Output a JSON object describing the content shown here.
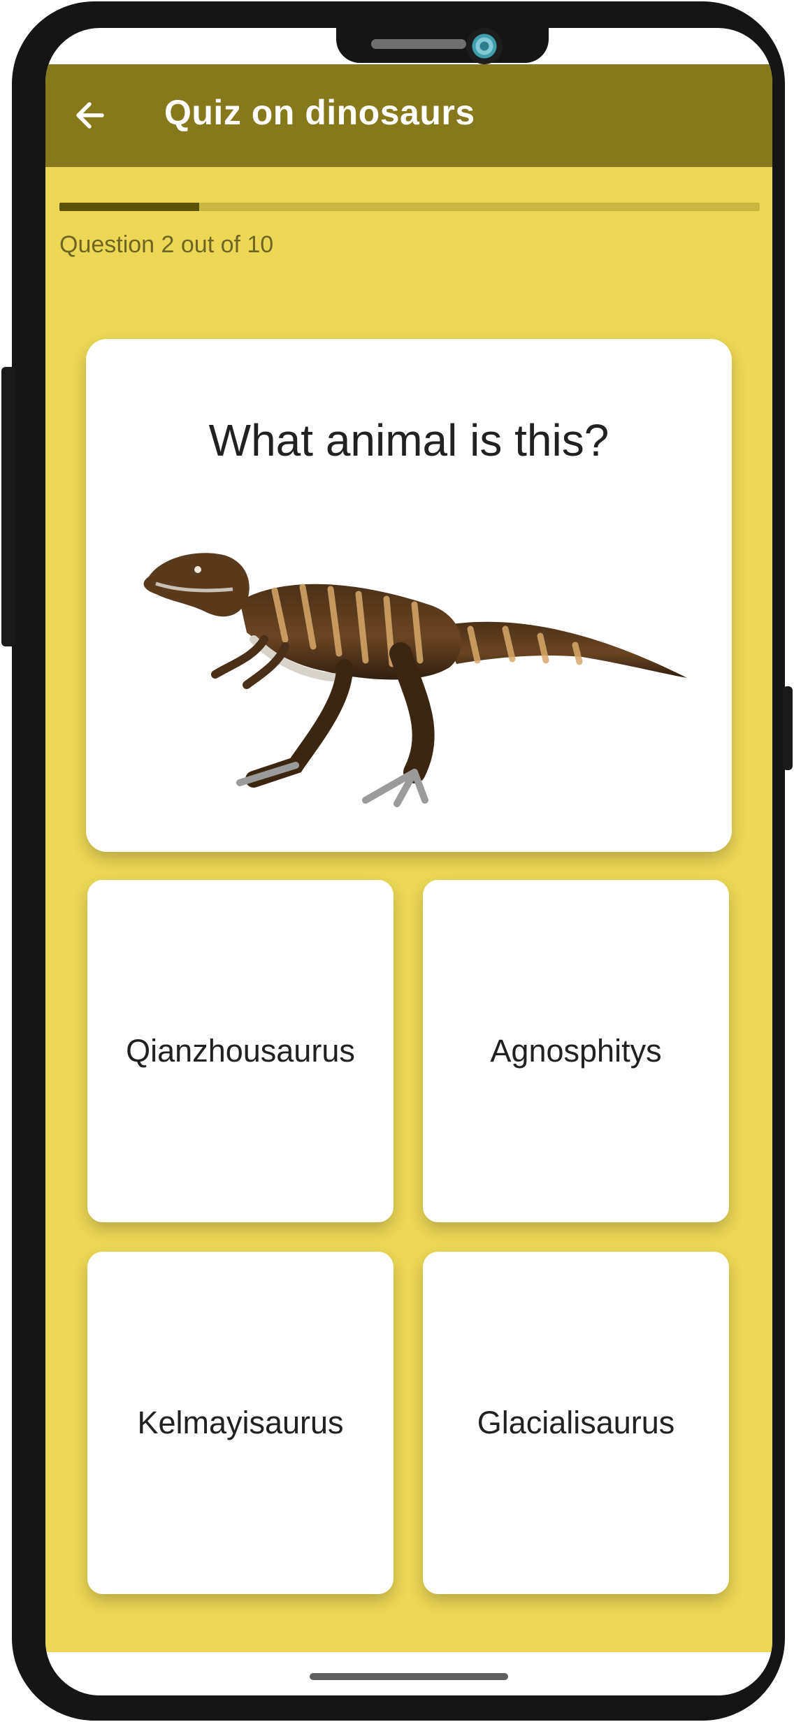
{
  "header": {
    "title": "Quiz on dinosaurs",
    "back_icon": "arrow-left-icon"
  },
  "progress": {
    "text": "Question 2 out of 10",
    "fraction": 0.2
  },
  "question": {
    "text": "What animal is this?",
    "image": "theropod-dinosaur-illustration"
  },
  "answers": [
    {
      "label": "Qianzhousaurus"
    },
    {
      "label": "Agnosphitys"
    },
    {
      "label": "Kelmayisaurus"
    },
    {
      "label": "Glacialisaurus"
    }
  ],
  "colors": {
    "app_bar": "#85791b",
    "background": "#ecd856",
    "progress_fill": "#5b520c",
    "progress_track": "#c9b83f",
    "card": "#ffffff"
  }
}
